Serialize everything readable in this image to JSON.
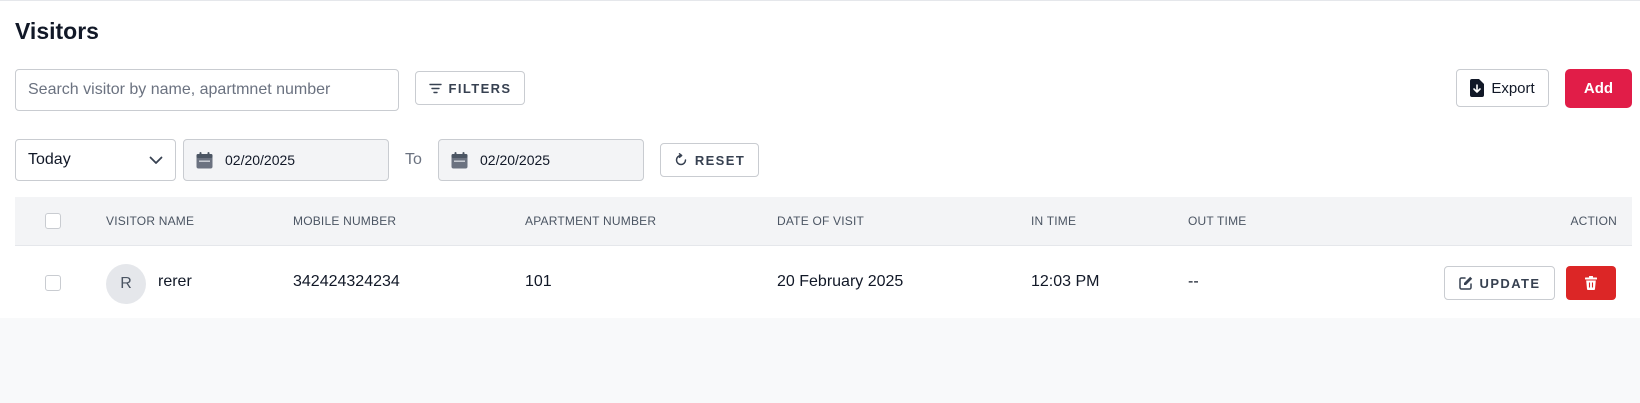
{
  "page": {
    "title": "Visitors"
  },
  "toolbar": {
    "search_placeholder": "Search visitor by name, apartmnet number",
    "filters_label": "FILTERS",
    "export_label": "Export",
    "add_label": "Add"
  },
  "date_filter": {
    "range_selected": "Today",
    "from": "02/20/2025",
    "to_label": "To",
    "to": "02/20/2025",
    "reset_label": "RESET"
  },
  "table": {
    "headers": {
      "visitor_name": "VISITOR NAME",
      "mobile_number": "MOBILE NUMBER",
      "apartment_number": "APARTMENT NUMBER",
      "date_of_visit": "DATE OF VISIT",
      "in_time": "IN TIME",
      "out_time": "OUT TIME",
      "action": "ACTION"
    },
    "rows": [
      {
        "avatar_initial": "R",
        "visitor_name": "rerer",
        "mobile_number": "342424324234",
        "apartment_number": "101",
        "date_of_visit": "20 February 2025",
        "in_time": "12:03 PM",
        "out_time": "--",
        "update_label": "UPDATE"
      }
    ]
  },
  "colors": {
    "accent": "#e11d48",
    "danger": "#dc2626",
    "header_bg": "#f3f4f6"
  },
  "icons": [
    "filter-icon",
    "export-file-icon",
    "chevron-down-icon",
    "calendar-icon",
    "reset-icon",
    "edit-icon",
    "trash-icon"
  ]
}
